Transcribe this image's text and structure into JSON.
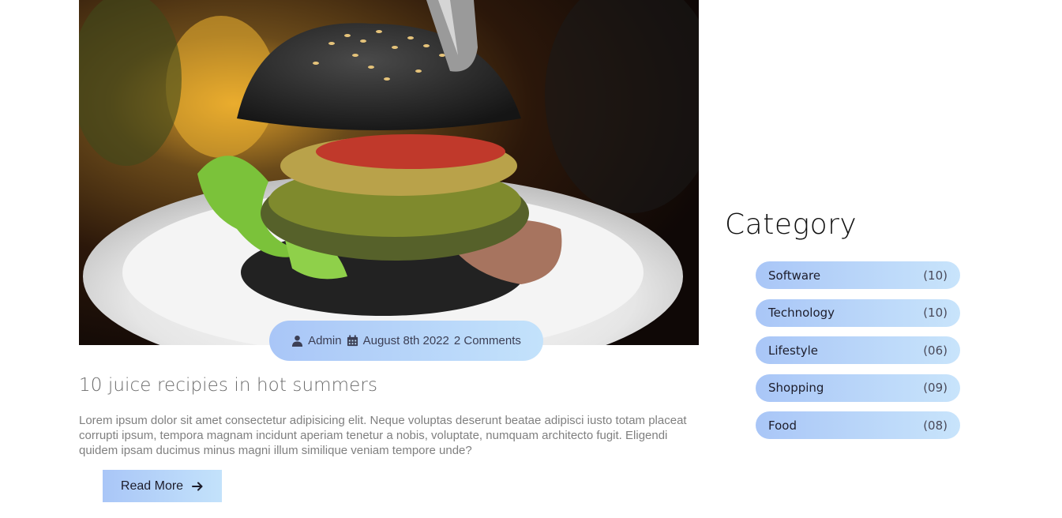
{
  "post": {
    "meta": {
      "author": "Admin",
      "date": "August 8th 2022",
      "comments": "2 Comments"
    },
    "title": "10 juice recipies in hot summers",
    "excerpt": "Lorem ipsum dolor sit amet consectetur adipisicing elit. Neque voluptas deserunt beatae adipisci iusto totam placeat corrupti ipsum, tempora magnam incidunt aperiam tenetur a nobis, voluptate, numquam architecto fugit. Eligendi quidem ipsam ducimus minus magni illum similique veniam tempore unde?",
    "read_more_label": "Read More"
  },
  "sidebar": {
    "title": "Category",
    "categories": [
      {
        "label": "Software",
        "count": "(10)"
      },
      {
        "label": "Technology",
        "count": "(10)"
      },
      {
        "label": "Lifestyle",
        "count": "(06)"
      },
      {
        "label": "Shopping",
        "count": "(09)"
      },
      {
        "label": "Food",
        "count": "(08)"
      }
    ]
  },
  "colors": {
    "accent_start": "#a9c6f7",
    "accent_end": "#c3e2fb"
  },
  "icons": {
    "author": "user-icon",
    "date": "calendar-icon",
    "read_more": "arrow-right-icon"
  }
}
